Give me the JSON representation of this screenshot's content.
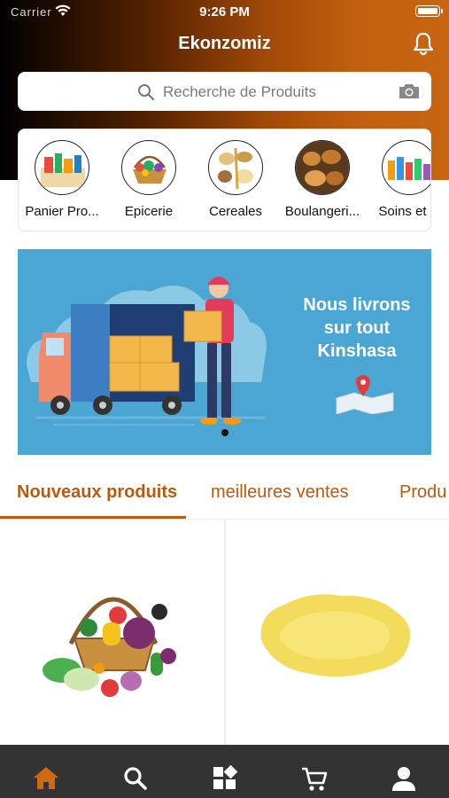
{
  "status_bar": {
    "carrier": "Carrier",
    "time": "9:26 PM"
  },
  "header": {
    "title": "Ekonzomiz"
  },
  "search": {
    "placeholder": "Recherche de Produits"
  },
  "categories": [
    {
      "label": "Panier Pro..."
    },
    {
      "label": "Epicerie"
    },
    {
      "label": "Cereales"
    },
    {
      "label": "Boulangeri..."
    },
    {
      "label": "Soins et H"
    }
  ],
  "banner": {
    "line1": "Nous livrons",
    "line2": "sur tout",
    "line3": "Kinshasa"
  },
  "tabs": [
    {
      "label": "Nouveaux produits",
      "active": true
    },
    {
      "label": "meilleures ventes",
      "active": false
    },
    {
      "label": "Produ",
      "active": false
    }
  ],
  "bottom_nav": {
    "active": "home"
  },
  "colors": {
    "accent": "#b85a10",
    "nav_bg": "#333333",
    "banner_bg": "#4ba6d3"
  }
}
